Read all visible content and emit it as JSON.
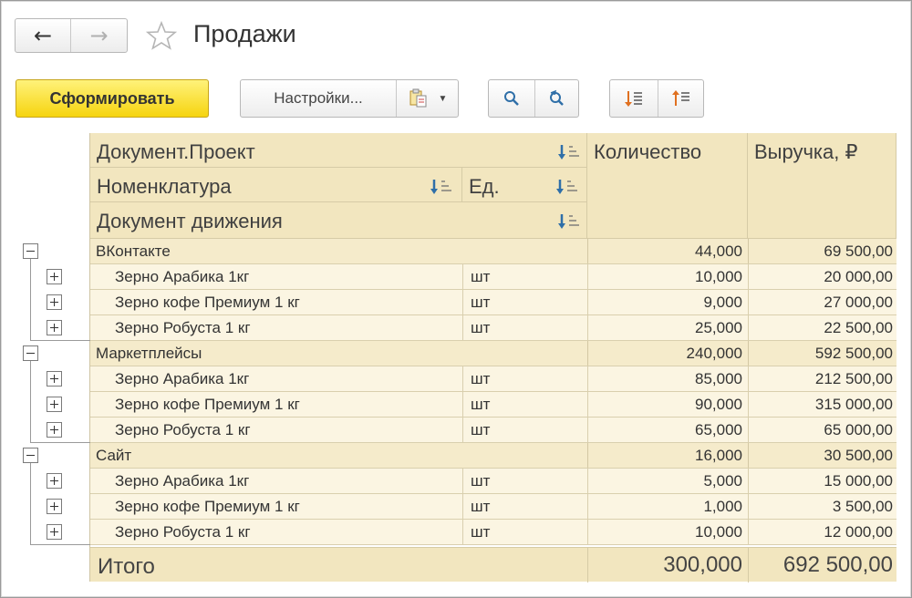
{
  "window": {
    "title": "Продажи",
    "nav_back_icon": "arrow-left-icon",
    "nav_forward_icon": "arrow-right-icon",
    "favorite_icon": "star-icon"
  },
  "toolbar": {
    "generate_label": "Сформировать",
    "settings_label": "Настройки...",
    "variant_icon": "report-variant-icon",
    "find_icon": "search-icon",
    "refresh_search_icon": "refresh-search-icon",
    "sort_desc_icon": "sort-descending-icon",
    "sort_asc_icon": "sort-ascending-icon"
  },
  "report": {
    "headers": {
      "project": "Документ.Проект",
      "nomenclature": "Номенклатура",
      "unit": "Ед.",
      "movement_doc": "Документ движения",
      "quantity": "Количество",
      "revenue": "Выручка, ₽"
    },
    "rows": [
      {
        "type": "group",
        "name": "ВКонтакте",
        "unit": "",
        "qty": "44,000",
        "revenue": "69 500,00"
      },
      {
        "type": "item",
        "name": "Зерно Арабика 1кг",
        "unit": "шт",
        "qty": "10,000",
        "revenue": "20 000,00"
      },
      {
        "type": "item",
        "name": "Зерно кофе Премиум 1 кг",
        "unit": "шт",
        "qty": "9,000",
        "revenue": "27 000,00"
      },
      {
        "type": "item",
        "name": "Зерно Робуста 1 кг",
        "unit": "шт",
        "qty": "25,000",
        "revenue": "22 500,00"
      },
      {
        "type": "group",
        "name": "Маркетплейсы",
        "unit": "",
        "qty": "240,000",
        "revenue": "592 500,00"
      },
      {
        "type": "item",
        "name": "Зерно Арабика 1кг",
        "unit": "шт",
        "qty": "85,000",
        "revenue": "212 500,00"
      },
      {
        "type": "item",
        "name": "Зерно кофе Премиум 1 кг",
        "unit": "шт",
        "qty": "90,000",
        "revenue": "315 000,00"
      },
      {
        "type": "item",
        "name": "Зерно Робуста 1 кг",
        "unit": "шт",
        "qty": "65,000",
        "revenue": "65 000,00"
      },
      {
        "type": "group",
        "name": "Сайт",
        "unit": "",
        "qty": "16,000",
        "revenue": "30 500,00"
      },
      {
        "type": "item",
        "name": "Зерно Арабика 1кг",
        "unit": "шт",
        "qty": "5,000",
        "revenue": "15 000,00"
      },
      {
        "type": "item",
        "name": "Зерно кофе Премиум 1 кг",
        "unit": "шт",
        "qty": "1,000",
        "revenue": "3 500,00"
      },
      {
        "type": "item",
        "name": "Зерно Робуста 1 кг",
        "unit": "шт",
        "qty": "10,000",
        "revenue": "12 000,00"
      }
    ],
    "total": {
      "label": "Итого",
      "qty": "300,000",
      "revenue": "692 500,00"
    }
  }
}
